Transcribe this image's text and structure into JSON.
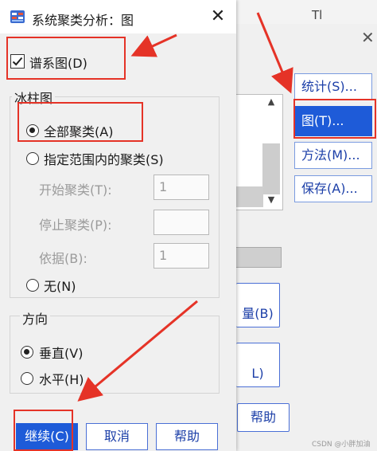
{
  "background_dialog": {
    "tab_letter": "Tl",
    "buttons": {
      "statistics": "统计(S)...",
      "statistics_underline": "S",
      "plots": "图(T)...",
      "method": "方法(M)...",
      "save": "保存(A)...",
      "partial_a": "量(B)",
      "partial_b": "L)",
      "help": "帮助"
    },
    "close_glyph": "✕",
    "watermark": "CSDN @小胖加油"
  },
  "dialog": {
    "title": "系统聚类分析：图",
    "close_glyph": "✕",
    "dendrogram": {
      "label": "谱系图(D)",
      "checked": true
    },
    "icicle": {
      "group_title": "冰柱图",
      "all_clusters": {
        "label": "全部聚类(A)",
        "selected": true
      },
      "range_clusters": {
        "label": "指定范围内的聚类(S)",
        "selected": false
      },
      "start_cluster": {
        "label": "开始聚类(T):",
        "value": "1"
      },
      "stop_cluster": {
        "label": "停止聚类(P):",
        "value": ""
      },
      "by": {
        "label": "依据(B):",
        "value": "1"
      },
      "none": {
        "label": "无(N)",
        "selected": false
      }
    },
    "orientation": {
      "group_title": "方向",
      "vertical": {
        "label": "垂直(V)",
        "selected": true
      },
      "horizontal": {
        "label": "水平(H)",
        "selected": false
      }
    },
    "buttons": {
      "continue": "继续(C)",
      "cancel": "取消",
      "help": "帮助"
    }
  },
  "colors": {
    "annotation_red": "#e53327",
    "primary_blue": "#1e5bd8",
    "dialog_bg": "#f0f0f0"
  }
}
